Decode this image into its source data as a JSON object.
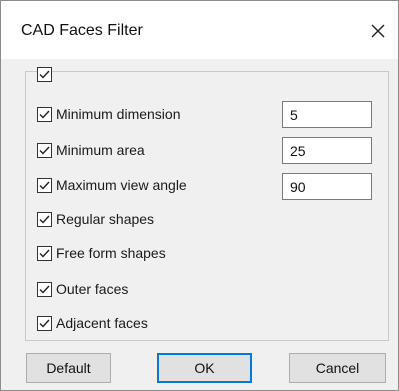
{
  "dialog": {
    "title": "CAD Faces Filter",
    "close_icon": "close-icon"
  },
  "filters": [
    {
      "label": "Minimum dimension",
      "checked": true,
      "value": "5"
    },
    {
      "label": "Minimum area",
      "checked": true,
      "value": "25"
    },
    {
      "label": "Maximum view angle",
      "checked": true,
      "value": "90"
    },
    {
      "label": "Regular shapes",
      "checked": true
    },
    {
      "label": "Free form shapes",
      "checked": true
    },
    {
      "label": "Outer faces",
      "checked": true
    },
    {
      "label": "Adjacent faces",
      "checked": true
    }
  ],
  "select_all_checked": true,
  "buttons": {
    "default": "Default",
    "ok": "OK",
    "cancel": "Cancel"
  },
  "colors": {
    "accent": "#0078d7",
    "dialog_bg": "#f0f0f0"
  }
}
